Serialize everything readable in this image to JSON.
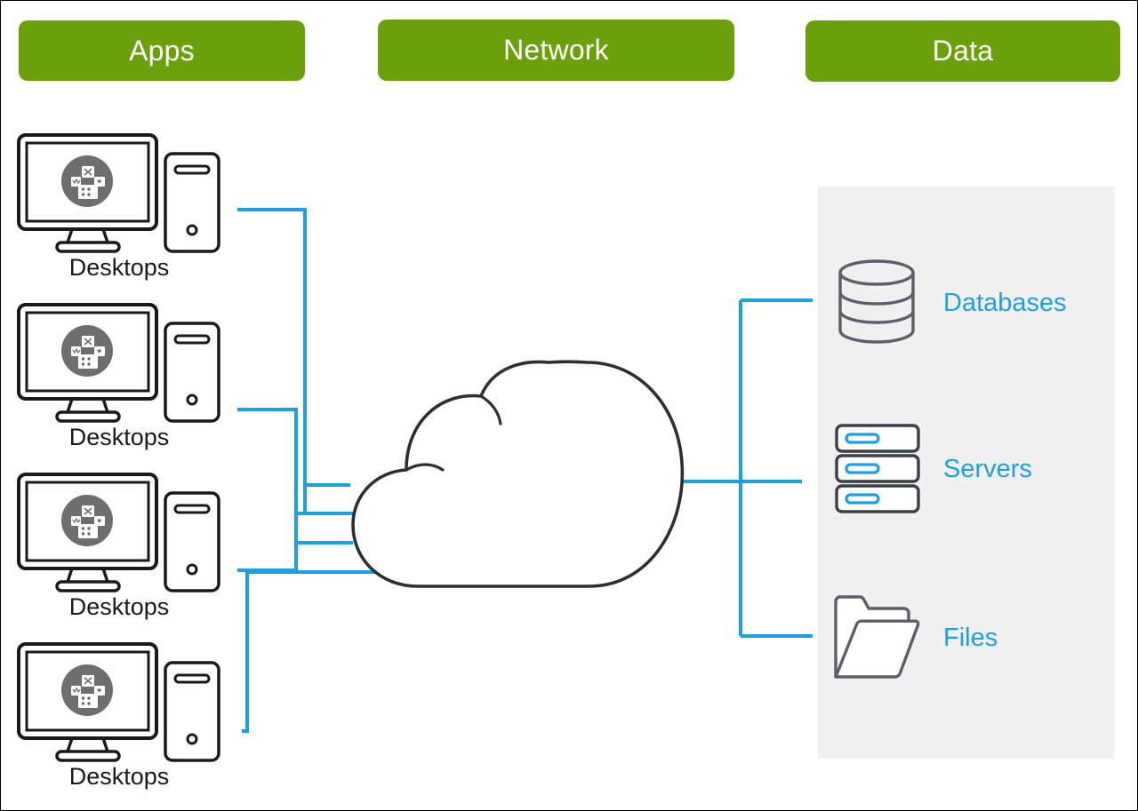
{
  "diagram": {
    "title": "Apps Network Data architecture diagram",
    "colors": {
      "header_green": "#6aa00a",
      "accent_blue": "#1ba1e2",
      "outline_dark": "#2f2f2f",
      "panel_gray": "#f0f0f0",
      "icon_gray": "#6e6e6e",
      "text_dark": "#1a1a1a",
      "frame_black": "#000000",
      "white": "#ffffff"
    }
  },
  "headers": [
    {
      "id": "apps",
      "label": "Apps"
    },
    {
      "id": "network",
      "label": "Network"
    },
    {
      "id": "data",
      "label": "Data"
    }
  ],
  "apps_column": {
    "label": "Apps",
    "items": [
      {
        "label": "Desktops",
        "icon": "desktop-computer-icon"
      },
      {
        "label": "Desktops",
        "icon": "desktop-computer-icon"
      },
      {
        "label": "Desktops",
        "icon": "desktop-computer-icon"
      },
      {
        "label": "Desktops",
        "icon": "desktop-computer-icon"
      }
    ]
  },
  "network_column": {
    "label": "Network",
    "node": {
      "label": "",
      "icon": "cloud-icon"
    }
  },
  "data_column": {
    "label": "Data",
    "items": [
      {
        "label": "Databases",
        "icon": "database-cylinder-icon"
      },
      {
        "label": "Servers",
        "icon": "server-stack-icon"
      },
      {
        "label": "Files",
        "icon": "folder-icon"
      }
    ]
  },
  "connections": {
    "left_label": "desktops-to-cloud",
    "right_label": "cloud-to-data",
    "count_left": 4,
    "count_right": 3
  }
}
